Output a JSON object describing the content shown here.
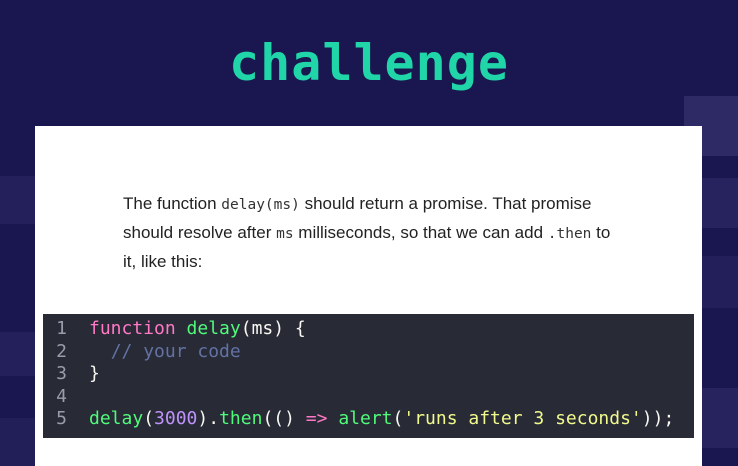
{
  "title": "challenge",
  "description": {
    "p1": "The function ",
    "c1": "delay(ms)",
    "p2": " should return a promise. That promise should resolve after ",
    "c2": "ms",
    "p3": " milliseconds, so that we can add ",
    "c3": ".then",
    "p4": " to it, like this:"
  },
  "code": {
    "line_numbers": [
      "1",
      "2",
      "3",
      "4",
      "5"
    ],
    "l1": {
      "kw": "function",
      "sp": " ",
      "fn": "delay",
      "rest": "(ms) {"
    },
    "l2": {
      "indent": "  ",
      "comment": "// your code"
    },
    "l3": {
      "text": "}"
    },
    "l5": {
      "fn1": "delay",
      "p1": "(",
      "num": "3000",
      "p2": ").",
      "fn2": "then",
      "p3": "(() ",
      "arrow": "=>",
      "p4": " ",
      "fn3": "alert",
      "p5": "(",
      "str": "'runs after 3 seconds'",
      "p6": "));"
    }
  },
  "colors": {
    "background": "#1a1650",
    "title": "#20d6a8",
    "code_background": "#282a36"
  }
}
